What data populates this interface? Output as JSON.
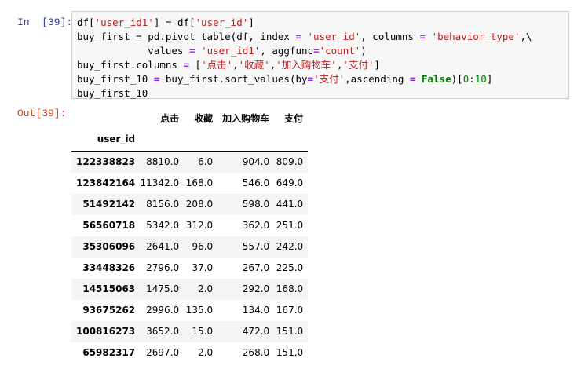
{
  "input_cell": {
    "prompt": "In  [39]:"
  },
  "output_cell": {
    "prompt": "Out[39]:"
  },
  "code": {
    "line1": {
      "p1": "df[",
      "s1": "'user_id1'",
      "p2": "] = df[",
      "s2": "'user_id'",
      "p3": "]"
    },
    "line2": {
      "p1": "buy_first = pd.pivot_table(df, index ",
      "o1": "=",
      "p2": " ",
      "s1": "'user_id'",
      "p3": ", columns ",
      "o2": "=",
      "p4": " ",
      "s2": "'behavior_type'",
      "p5": ",\\"
    },
    "line3": {
      "p1": "            values ",
      "o1": "=",
      "p2": " ",
      "s1": "'user_id1'",
      "p3": ", aggfunc",
      "o2": "=",
      "s2": "'count'",
      "p4": ")"
    },
    "line4": {
      "p1": "buy_first.columns ",
      "o1": "=",
      "p2": " [",
      "s1": "'点击'",
      "p3": ",",
      "s2": "'收藏'",
      "p4": ",",
      "s3": "'加入购物车'",
      "p5": ",",
      "s4": "'支付'",
      "p6": "]"
    },
    "line5": {
      "p1": "buy_first_10 ",
      "o1": "=",
      "p2": " buy_first.sort_values(by",
      "o2": "=",
      "s1": "'支付'",
      "p3": ",ascending ",
      "o3": "=",
      "p4": " ",
      "k1": "False",
      "p5": ")[",
      "n1": "0",
      "p6": ":",
      "n2": "10",
      "p7": "]"
    },
    "line6": {
      "p1": "buy_first_10"
    }
  },
  "table": {
    "index_name": "user_id",
    "columns": [
      "点击",
      "收藏",
      "加入购物车",
      "支付"
    ],
    "rows": [
      {
        "index": "122338823",
        "values": [
          "8810.0",
          "6.0",
          "904.0",
          "809.0"
        ]
      },
      {
        "index": "123842164",
        "values": [
          "11342.0",
          "168.0",
          "546.0",
          "649.0"
        ]
      },
      {
        "index": "51492142",
        "values": [
          "8156.0",
          "208.0",
          "598.0",
          "441.0"
        ]
      },
      {
        "index": "56560718",
        "values": [
          "5342.0",
          "312.0",
          "362.0",
          "251.0"
        ]
      },
      {
        "index": "35306096",
        "values": [
          "2641.0",
          "96.0",
          "557.0",
          "242.0"
        ]
      },
      {
        "index": "33448326",
        "values": [
          "2796.0",
          "37.0",
          "267.0",
          "225.0"
        ]
      },
      {
        "index": "14515063",
        "values": [
          "1475.0",
          "2.0",
          "292.0",
          "168.0"
        ]
      },
      {
        "index": "93675262",
        "values": [
          "2996.0",
          "135.0",
          "134.0",
          "167.0"
        ]
      },
      {
        "index": "100816273",
        "values": [
          "3652.0",
          "15.0",
          "472.0",
          "151.0"
        ]
      },
      {
        "index": "65982317",
        "values": [
          "2697.0",
          "2.0",
          "268.0",
          "151.0"
        ]
      }
    ]
  }
}
